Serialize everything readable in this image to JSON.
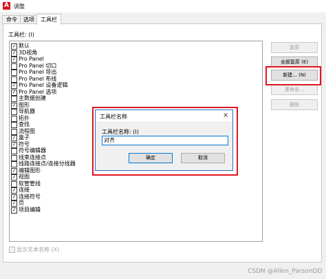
{
  "window": {
    "title": "调整",
    "app_icon_glyph": "A"
  },
  "tabs": [
    {
      "label": "命令",
      "active": false
    },
    {
      "label": "选项",
      "active": false
    },
    {
      "label": "工具栏",
      "active": true
    }
  ],
  "toolbar_panel": {
    "list_label": "工具栏: (I)",
    "items": [
      {
        "label": "默认",
        "checked": true
      },
      {
        "label": "3D视角",
        "checked": true
      },
      {
        "label": "Pro Panel",
        "checked": true
      },
      {
        "label": "Pro Panel 切口",
        "checked": false
      },
      {
        "label": "Pro Panel 导出",
        "checked": false
      },
      {
        "label": "Pro Panel 布线",
        "checked": false
      },
      {
        "label": "Pro Panel 设备逻辑",
        "checked": true
      },
      {
        "label": "Pro Panel 选项",
        "checked": true
      },
      {
        "label": "主数据创建",
        "checked": false
      },
      {
        "label": "图形",
        "checked": true
      },
      {
        "label": "导航器",
        "checked": false
      },
      {
        "label": "拓扑",
        "checked": false
      },
      {
        "label": "查找",
        "checked": false
      },
      {
        "label": "流程图",
        "checked": false
      },
      {
        "label": "盒子",
        "checked": true
      },
      {
        "label": "符号",
        "checked": true
      },
      {
        "label": "符号编辑器",
        "checked": false
      },
      {
        "label": "线束连接点",
        "checked": false
      },
      {
        "label": "线路连接点/连接分线器",
        "checked": false
      },
      {
        "label": "编辑图形",
        "checked": true
      },
      {
        "label": "视图",
        "checked": true
      },
      {
        "label": "软管管线",
        "checked": false
      },
      {
        "label": "连接",
        "checked": true
      },
      {
        "label": "连接符号",
        "checked": true
      },
      {
        "label": "页",
        "checked": true
      },
      {
        "label": "项目编辑",
        "checked": true
      }
    ],
    "show_text_label": "显示文本名称 (X)",
    "show_text_checked": false
  },
  "buttons": {
    "restore": "复原",
    "restore_all": "全部复原 (E)",
    "new": "新建... (N)",
    "rename": "重命名...",
    "delete": "删除"
  },
  "dialog": {
    "title": "工具栏名称",
    "field_label": "工具栏名称: (I)",
    "field_value": "对齐",
    "ok_label": "确定",
    "cancel_label": "取消",
    "close_glyph": "×"
  },
  "watermark": "CSDN @Allen_ParsonDD",
  "colors": {
    "highlight": "#e0141e",
    "accent": "#0078d7",
    "app_icon": "#d4161c"
  }
}
